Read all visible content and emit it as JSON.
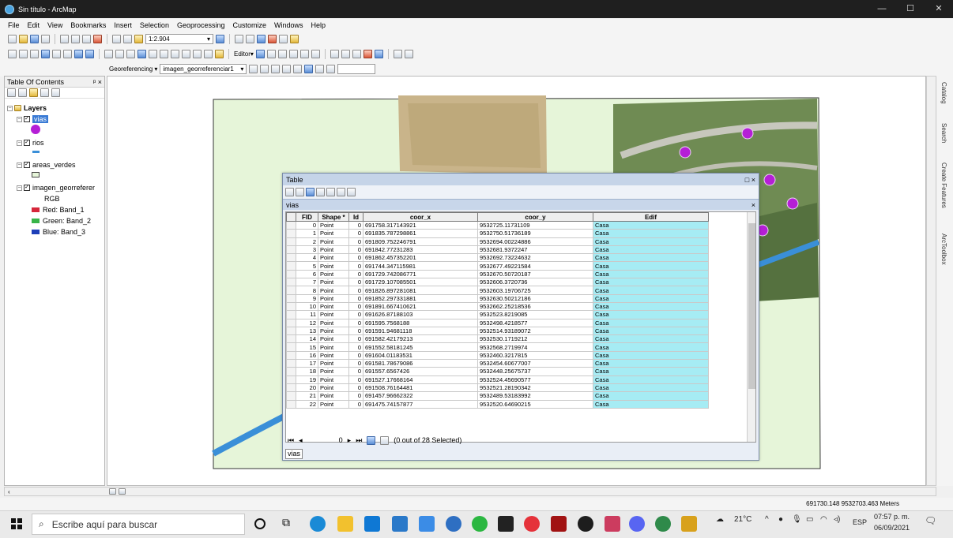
{
  "window": {
    "title": "Sin título - ArcMap",
    "controls": [
      "—",
      "☐",
      "✕"
    ]
  },
  "menu": [
    "File",
    "Edit",
    "View",
    "Bookmarks",
    "Insert",
    "Selection",
    "Geoprocessing",
    "Customize",
    "Windows",
    "Help"
  ],
  "toolbar": {
    "scale": "1:2.904",
    "editor_label": "Editor▾"
  },
  "georef": {
    "label": "Georeferencing ▾",
    "layer": "imagen_georreferenciar1"
  },
  "toc": {
    "title": "Table Of Contents",
    "pin": "ᵖ ×",
    "root": "Layers",
    "layers": [
      {
        "name": "vias",
        "selected": true
      },
      {
        "name": "rios"
      },
      {
        "name": "areas_verdes"
      },
      {
        "name": "imagen_georreferer"
      }
    ],
    "rgb_label": "RGB",
    "bands": [
      "Red:   Band_1",
      "Green: Band_2",
      "Blue:  Band_3"
    ],
    "colors": {
      "vias": "#b51fd6",
      "rios": "#3a8fd8",
      "areas_verdes": "#e6f5d9"
    }
  },
  "right_tabs": [
    "Catalog",
    "Search",
    "Create Features",
    "ArcToolbox"
  ],
  "status": {
    "coords": "691730.148  9532703.463 Meters"
  },
  "table_window": {
    "title": "Table",
    "close": "□ ×",
    "tab": "vias",
    "columns": [
      "FID",
      "Shape *",
      "Id",
      "coor_x",
      "coor_y",
      "Edif"
    ],
    "rows": [
      [
        "0",
        "Point",
        "0",
        "691758.317143921",
        "9532725.11731109",
        "Casa"
      ],
      [
        "1",
        "Point",
        "0",
        "691835.787298861",
        "9532750.51736189",
        "Casa"
      ],
      [
        "2",
        "Point",
        "0",
        "691809.752246791",
        "9532694.00224886",
        "Casa"
      ],
      [
        "3",
        "Point",
        "0",
        "691842.77231283",
        "9532681.9372247",
        "Casa"
      ],
      [
        "4",
        "Point",
        "0",
        "691862.457352201",
        "9532692.73224632",
        "Casa"
      ],
      [
        "5",
        "Point",
        "0",
        "691744.347115981",
        "9532677.49221584",
        "Casa"
      ],
      [
        "6",
        "Point",
        "0",
        "691729.742086771",
        "9532670.50720187",
        "Casa"
      ],
      [
        "7",
        "Point",
        "0",
        "691729.107085501",
        "9532606.3720736",
        "Casa"
      ],
      [
        "8",
        "Point",
        "0",
        "691826.897281081",
        "9532603.19706725",
        "Casa"
      ],
      [
        "9",
        "Point",
        "0",
        "691852.297331881",
        "9532630.50212186",
        "Casa"
      ],
      [
        "10",
        "Point",
        "0",
        "691891.667410621",
        "9532662.25218536",
        "Casa"
      ],
      [
        "11",
        "Point",
        "0",
        "691626.87188103",
        "9532523.8219085",
        "Casa"
      ],
      [
        "12",
        "Point",
        "0",
        "691595.7568188",
        "9532498.4218577",
        "Casa"
      ],
      [
        "13",
        "Point",
        "0",
        "691591.94681118",
        "9532514.93189072",
        "Casa"
      ],
      [
        "14",
        "Point",
        "0",
        "691582.42179213",
        "9532530.1719212",
        "Casa"
      ],
      [
        "15",
        "Point",
        "0",
        "691552.58181245",
        "9532568.2719974",
        "Casa"
      ],
      [
        "16",
        "Point",
        "0",
        "691604.01183531",
        "9532460.3217815",
        "Casa"
      ],
      [
        "17",
        "Point",
        "0",
        "691581.78679086",
        "9532454.60677007",
        "Casa"
      ],
      [
        "18",
        "Point",
        "0",
        "691557.6567426",
        "9532448.25675737",
        "Casa"
      ],
      [
        "19",
        "Point",
        "0",
        "691527.17668164",
        "9532524.45690577",
        "Casa"
      ],
      [
        "20",
        "Point",
        "0",
        "691508.76164481",
        "9532521.28190342",
        "Casa"
      ],
      [
        "21",
        "Point",
        "0",
        "691457.96662322",
        "9532489.53183992",
        "Casa"
      ],
      [
        "22",
        "Point",
        "0",
        "691475.74157877",
        "9532520.64690215",
        "Casa"
      ]
    ],
    "footer": {
      "record": "0",
      "selected": "(0 out of 28 Selected)"
    },
    "tab_name": "vias"
  },
  "taskbar": {
    "search_placeholder": "Escribe aquí para buscar",
    "weather": "21°C",
    "lang": "ESP",
    "time": "07:57 p. m.",
    "date": "06/09/2021"
  }
}
